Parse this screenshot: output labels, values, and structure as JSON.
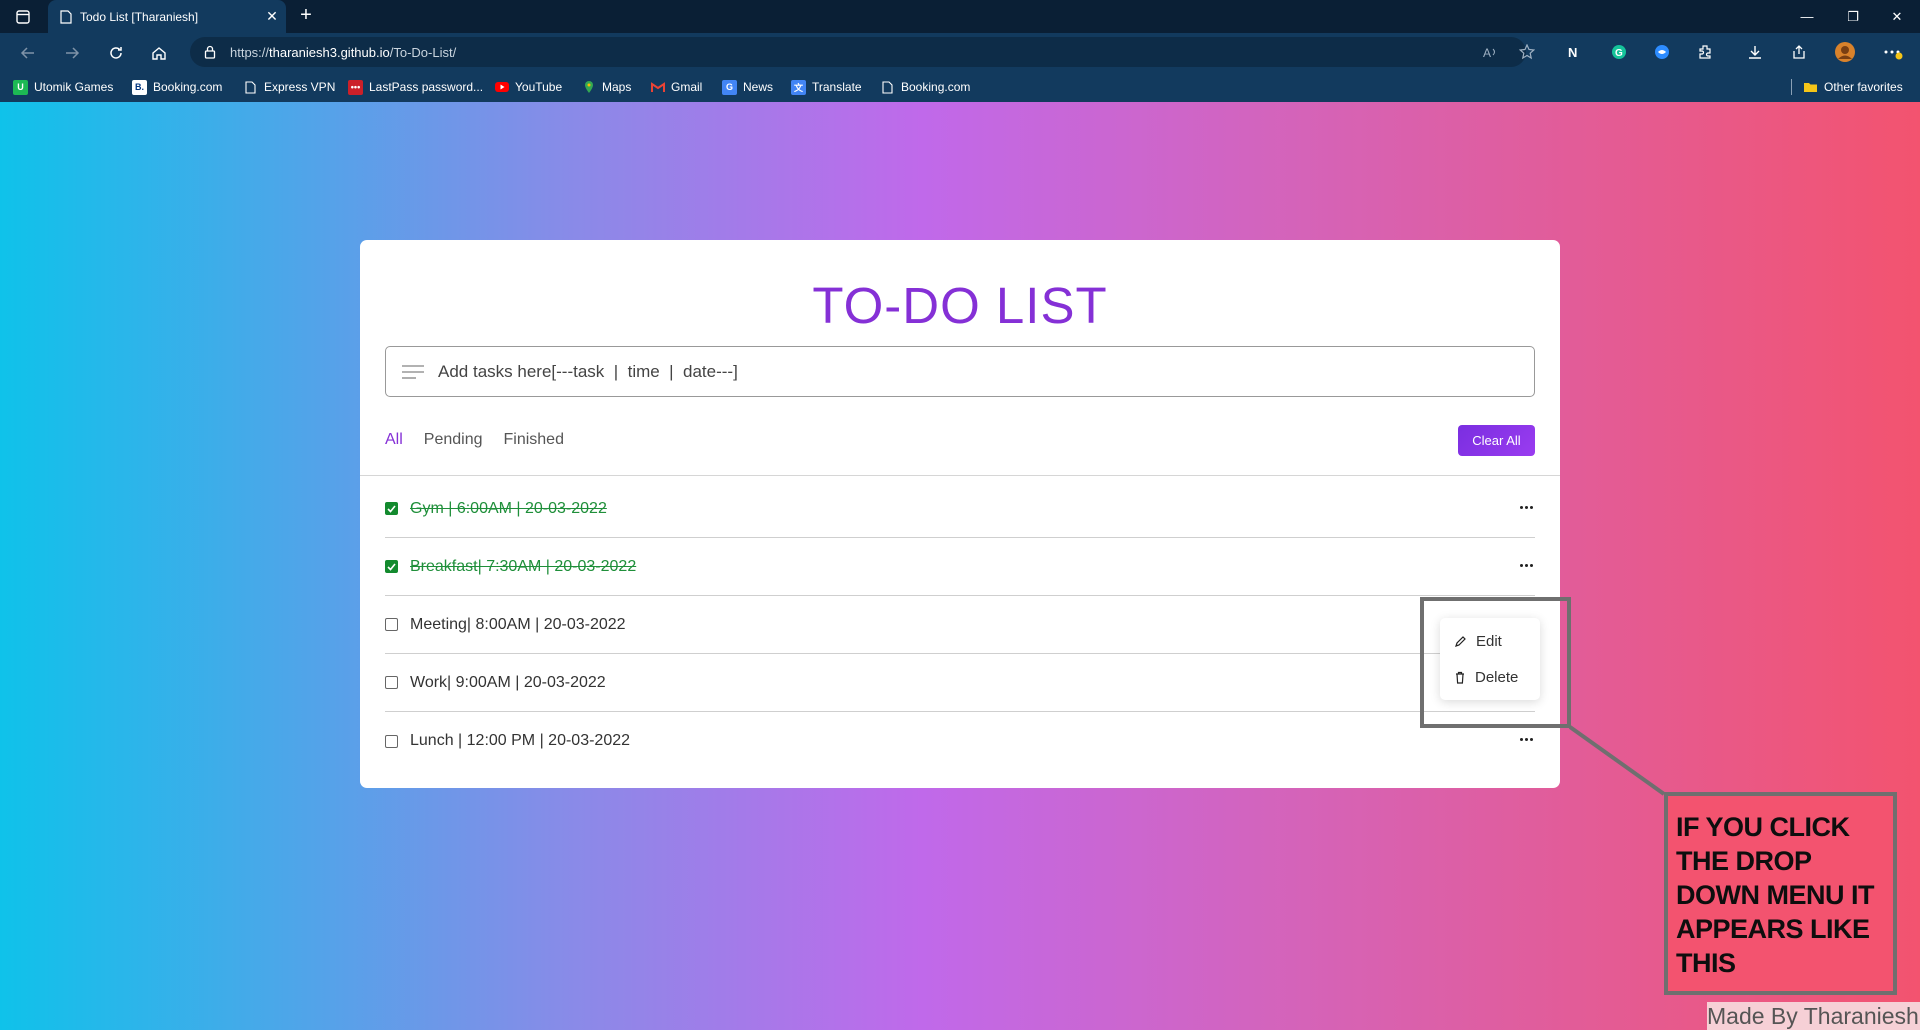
{
  "browser": {
    "tab_title": "Todo List [Tharaniesh]",
    "tab_close": "✕",
    "new_tab": "+",
    "url_scheme": "https://",
    "url_host": "tharaniesh3.github.io",
    "url_path": "/To-Do-List/",
    "window_controls": [
      "—",
      "❐",
      "✕"
    ]
  },
  "favorites": [
    {
      "label": "Utomik Games",
      "icon": "utomik-icon",
      "color": "#1db954"
    },
    {
      "label": "Booking.com",
      "icon": "booking-icon",
      "color": "#ffffff"
    },
    {
      "label": "Express VPN",
      "icon": "page-icon",
      "color": "#ffffff"
    },
    {
      "label": "LastPass password...",
      "icon": "lastpass-icon",
      "color": "#cc2029"
    },
    {
      "label": "YouTube",
      "icon": "youtube-icon",
      "color": "#ff0000"
    },
    {
      "label": "Maps",
      "icon": "maps-icon",
      "color": "#34a853"
    },
    {
      "label": "Gmail",
      "icon": "gmail-icon",
      "color": "#ea4335"
    },
    {
      "label": "News",
      "icon": "news-icon",
      "color": "#4285f4"
    },
    {
      "label": "Translate",
      "icon": "translate-icon",
      "color": "#4285f4"
    },
    {
      "label": "Booking.com",
      "icon": "page-icon",
      "color": "#ffffff"
    }
  ],
  "other_favorites": "Other favorites",
  "app": {
    "title": "TO-DO LIST",
    "input_placeholder": "Add tasks here[---task  |  time  |  date---]",
    "filters": [
      "All",
      "Pending",
      "Finished"
    ],
    "active_filter": "All",
    "clear_all": "Clear All",
    "accent_color": "#8530d6",
    "done_color": "#1f8f3a"
  },
  "tasks": [
    {
      "label": "Gym | 6:00AM | 20-03-2022",
      "done": true
    },
    {
      "label": "Breakfast| 7:30AM | 20-03-2022",
      "done": true
    },
    {
      "label": "Meeting| 8:00AM | 20-03-2022",
      "done": false
    },
    {
      "label": "Work| 9:00AM | 20-03-2022",
      "done": false
    },
    {
      "label": "Lunch | 12:00 PM | 20-03-2022",
      "done": false
    }
  ],
  "dropdown": {
    "edit": "Edit",
    "delete": "Delete"
  },
  "annotation": {
    "note": "IF YOU CLICK THE DROP DOWN MENU IT APPEARS LIKE THIS",
    "credit": "Made By Tharaniesh"
  }
}
